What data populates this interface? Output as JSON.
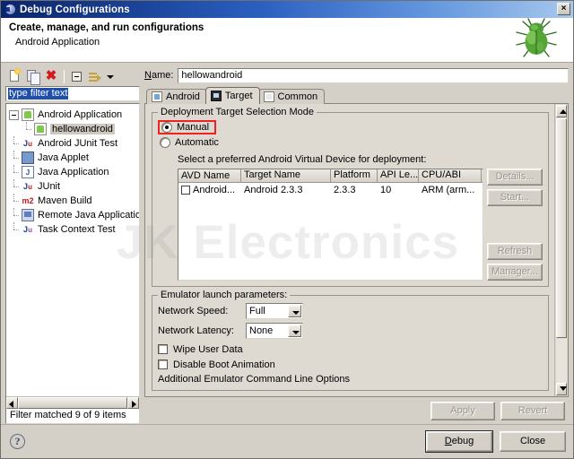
{
  "window": {
    "title": "Debug Configurations",
    "close_label": "×",
    "header_title": "Create, manage, and run configurations",
    "header_subtitle": "Android Application"
  },
  "left_panel": {
    "toolbar": {
      "new_tip": "New launch configuration",
      "duplicate_tip": "Duplicate",
      "delete_tip": "Delete",
      "collapse_tip": "Collapse All",
      "filter_tip": "Filter",
      "menu_tip": "View Menu"
    },
    "filter_input": {
      "value": "type filter text",
      "placeholder": "type filter text"
    },
    "tree": [
      {
        "label": "Android Application",
        "icon": "android-icon",
        "expanded": true,
        "depth": 0
      },
      {
        "label": "hellowandroid",
        "icon": "android-icon",
        "selected": true,
        "depth": 1
      },
      {
        "label": "Android JUnit Test",
        "icon": "junit-icon",
        "depth": 0
      },
      {
        "label": "Java Applet",
        "icon": "applet-icon",
        "depth": 0
      },
      {
        "label": "Java Application",
        "icon": "java-icon",
        "depth": 0
      },
      {
        "label": "JUnit",
        "icon": "junit-icon",
        "depth": 0
      },
      {
        "label": "Maven Build",
        "icon": "maven-icon",
        "depth": 0
      },
      {
        "label": "Remote Java Applicatio",
        "icon": "remote-icon",
        "depth": 0
      },
      {
        "label": "Task Context Test",
        "icon": "task-icon",
        "depth": 0
      }
    ],
    "status": "Filter matched 9 of 9 items"
  },
  "right_panel": {
    "name_label": "Name:",
    "name_value": "hellowandroid",
    "tabs": [
      {
        "label": "Android",
        "icon": "android-tab-icon",
        "active": false
      },
      {
        "label": "Target",
        "icon": "target-tab-icon",
        "active": true
      },
      {
        "label": "Common",
        "icon": "common-tab-icon",
        "active": false
      }
    ],
    "deployment": {
      "group_label": "Deployment Target Selection Mode",
      "manual_label": "Manual",
      "automatic_label": "Automatic",
      "selected": "Manual",
      "highlighted": "Manual",
      "highlight_color": "#ee2222",
      "note": "Select a preferred Android Virtual Device for deployment:"
    },
    "avd_table": {
      "columns": [
        "AVD Name",
        "Target Name",
        "Platform",
        "API Le...",
        "CPU/ABI",
        ""
      ],
      "rows": [
        {
          "checked": false,
          "cells": [
            "Android...",
            "Android 2.3.3",
            "2.3.3",
            "10",
            "ARM (arm...",
            ""
          ]
        }
      ]
    },
    "avd_buttons": [
      {
        "label": "Details...",
        "disabled": true
      },
      {
        "label": "Start...",
        "disabled": true
      },
      {
        "label": "Refresh",
        "disabled": true
      },
      {
        "label": "Manager...",
        "disabled": true
      }
    ],
    "emulator": {
      "group_label": "Emulator launch parameters:",
      "network_speed_label": "Network Speed:",
      "network_speed_value": "Full",
      "network_latency_label": "Network Latency:",
      "network_latency_value": "None",
      "wipe_user_data_label": "Wipe User Data",
      "wipe_user_data_checked": false,
      "disable_boot_animation_label": "Disable Boot Animation",
      "disable_boot_animation_checked": false,
      "additional_options_label": "Additional Emulator Command Line Options"
    },
    "apply_label": "Apply",
    "revert_label": "Revert",
    "apply_disabled": true,
    "revert_disabled": true
  },
  "footer": {
    "help_glyph": "?",
    "debug_label": "Debug",
    "close_label": "Close"
  },
  "watermark": "JK Electronics"
}
